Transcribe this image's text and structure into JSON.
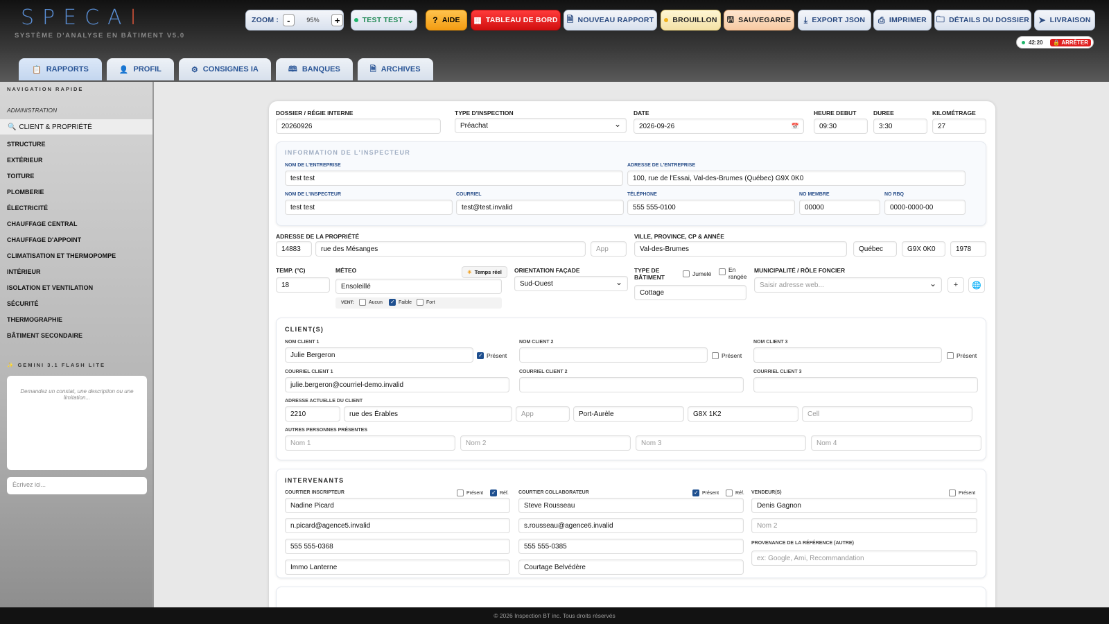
{
  "header": {
    "logo_main": "SPECA",
    "logo_last": "I",
    "subtitle": "SYSTÈME D'ANALYSE EN BÂTIMENT V5.0"
  },
  "toolbar": {
    "zoom_label": "ZOOM :",
    "zoom_minus": "-",
    "zoom_value": "95%",
    "zoom_plus": "+",
    "user": "TEST TEST",
    "aide": "AIDE",
    "tableau": "TABLEAU DE BORD",
    "nouveau": "NOUVEAU RAPPORT",
    "brouillon": "BROUILLON",
    "sauvegarde": "SAUVEGARDE",
    "export": "EXPORT JSON",
    "imprimer": "IMPRIMER",
    "details": "DÉTAILS DU DOSSIER",
    "livraison": "LIVRAISON",
    "timer": "42:20",
    "arreter": "ARRÊTER"
  },
  "tabs": [
    "RAPPORTS",
    "PROFIL",
    "CONSIGNES IA",
    "BANQUES",
    "ARCHIVES"
  ],
  "sidebar": {
    "nav_title": "NAVIGATION RAPIDE",
    "admin": "ADMINISTRATION",
    "selected": "CLIENT & PROPRIÉTÉ",
    "items": [
      "STRUCTURE",
      "EXTÉRIEUR",
      "TOITURE",
      "PLOMBERIE",
      "ÉLECTRICITÉ",
      "CHAUFFAGE CENTRAL",
      "CHAUFFAGE D'APPOINT",
      "CLIMATISATION ET THERMOPOMPE",
      "INTÉRIEUR",
      "ISOLATION ET VENTILATION",
      "SÉCURITÉ",
      "THERMOGRAPHIE",
      "BÂTIMENT SECONDAIRE"
    ],
    "ai_title": "GEMINI 3.1 FLASH LITE",
    "ai_placeholder": "Demandez un constat, une description ou une limitation...",
    "ai_input_placeholder": "Écrivez ici..."
  },
  "form": {
    "dossier_label": "DOSSIER / RÉGIE INTERNE",
    "dossier": "20260926",
    "type_label": "TYPE D'INSPECTION",
    "type": "Préachat",
    "date_label": "DATE",
    "date": "2026-09-26",
    "heure_label": "HEURE DEBUT",
    "heure": "09:30",
    "duree_label": "DUREE",
    "duree": "3:30",
    "km_label": "KILOMÉTRAGE",
    "km": "27",
    "insp_title": "INFORMATION DE L'INSPECTEUR",
    "ent_label": "NOM DE L'ENTREPRISE",
    "ent": "test test",
    "adr_ent_label": "ADRESSE DE L'ENTREPRISE",
    "adr_ent": "100, rue de l'Essai, Val-des-Brumes (Québec) G9X 0K0",
    "insp_label": "NOM DE L'INSPECTEUR",
    "insp": "test test",
    "courriel_label": "COURRIEL",
    "courriel": "test@test.invalid",
    "tel_label": "TÉLÉPHONE",
    "tel": "555 555-0100",
    "membre_label": "NO MEMBRE",
    "membre": "00000",
    "rbq_label": "NO RBQ",
    "rbq": "0000-0000-00",
    "adr_prop_label": "ADRESSE DE LA PROPRIÉTÉ",
    "num": "14883",
    "rue": "rue des Mésanges",
    "app_ph": "App",
    "ville_label": "VILLE, PROVINCE, CP & ANNÉE",
    "ville": "Val-des-Brumes",
    "prov": "Québec",
    "cp": "G9X 0K0",
    "annee": "1978",
    "temp_label": "TEMP. (°C)",
    "temp": "18",
    "meteo_label": "MÉTEO",
    "temps_reel": "Temps réel",
    "meteo": "Ensoleillé",
    "vent_label": "VENT:",
    "vent_opts": [
      "Aucun",
      "Faible",
      "Fort"
    ],
    "orient_label": "ORIENTATION FAÇADE",
    "orient": "Sud-Ouest",
    "type_bat_label": "TYPE DE BÂTIMENT",
    "jumele": "Jumelé",
    "rangee": "En rangée",
    "type_bat": "Cottage",
    "muni_label": "MUNICIPALITÉ / RÔLE FONCIER",
    "muni_ph": "Saisir adresse web...",
    "plus": "+"
  },
  "clients": {
    "title": "CLIENT(S)",
    "nom_labels": [
      "NOM CLIENT 1",
      "NOM CLIENT 2",
      "NOM CLIENT 3"
    ],
    "noms": [
      "Julie Bergeron",
      "",
      ""
    ],
    "present": "Présent",
    "courriel_labels": [
      "COURRIEL CLIENT 1",
      "COURRIEL CLIENT 2",
      "COURRIEL CLIENT 3"
    ],
    "courriels": [
      "julie.bergeron@courriel-demo.invalid",
      "",
      ""
    ],
    "adr_label": "ADRESSE ACTUELLE DU CLIENT",
    "adr_num": "2210",
    "adr_rue": "rue des Érables",
    "adr_app": "App",
    "adr_ville": "Port-Aurèle",
    "adr_cp": "G8X 1K2",
    "adr_cell": "Cell",
    "autres_label": "AUTRES PERSONNES PRÉSENTES",
    "autres": [
      "Nom 1",
      "Nom 2",
      "Nom 3",
      "Nom 4"
    ]
  },
  "intervenants": {
    "title": "INTERVENANTS",
    "c1_label": "COURTIER INSCRIPTEUR",
    "c2_label": "COURTIER COLLABORATEUR",
    "v_label": "VENDEUR(S)",
    "present": "Présent",
    "ref": "Réf.",
    "c1": [
      "Nadine Picard",
      "n.picard@agence5.invalid",
      "555 555-0368",
      "Immo Lanterne"
    ],
    "c2": [
      "Steve Rousseau",
      "s.rousseau@agence6.invalid",
      "555 555-0385",
      "Courtage Belvédère"
    ],
    "v1": "Denis Gagnon",
    "v2_ph": "Nom 2",
    "prov_label": "PROVENANCE DE LA RÉFÉRENCE (AUTRE)",
    "prov_ph": "ex: Google, Ami, Recommandation"
  },
  "footer": "© 2026 Inspection BT inc. Tous droits réservés"
}
